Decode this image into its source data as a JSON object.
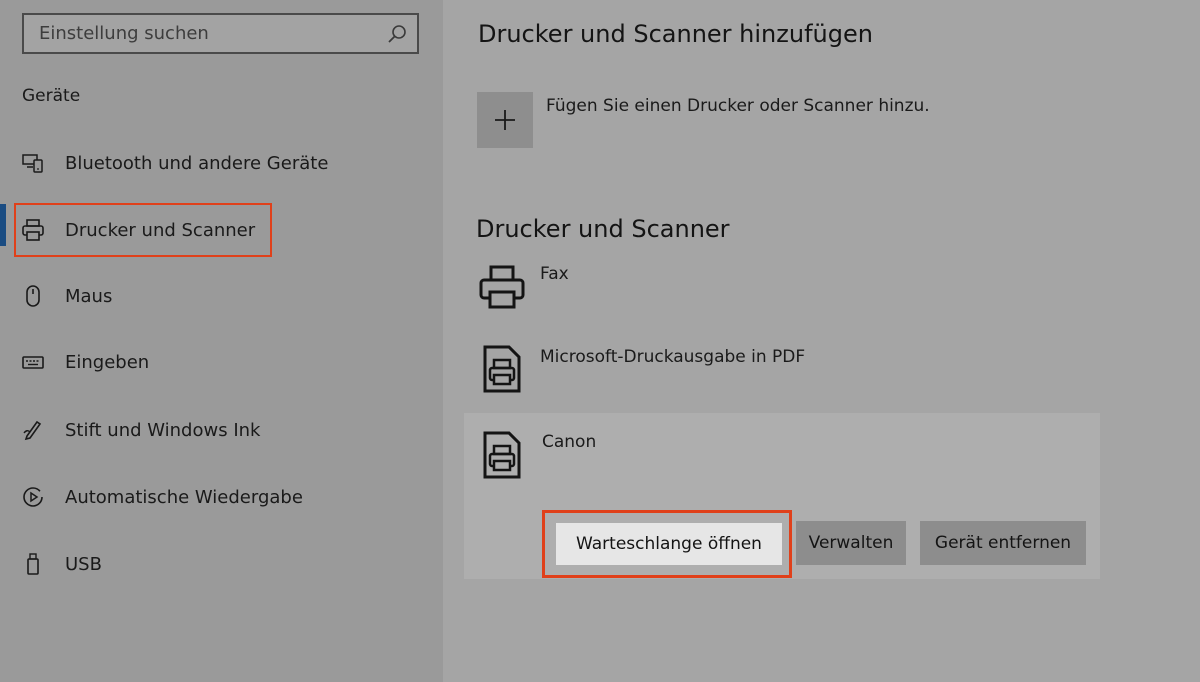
{
  "search": {
    "placeholder": "Einstellung suchen"
  },
  "sidebar": {
    "section_title": "Geräte",
    "items": [
      {
        "label": "Bluetooth und andere Geräte",
        "icon": "bluetooth-devices-icon"
      },
      {
        "label": "Drucker und Scanner",
        "icon": "printer-icon",
        "active": true
      },
      {
        "label": "Maus",
        "icon": "mouse-icon"
      },
      {
        "label": "Eingeben",
        "icon": "keyboard-icon"
      },
      {
        "label": "Stift und Windows Ink",
        "icon": "pen-icon"
      },
      {
        "label": "Automatische Wiedergabe",
        "icon": "autoplay-icon"
      },
      {
        "label": "USB",
        "icon": "usb-icon"
      }
    ]
  },
  "main": {
    "add_section_title": "Drucker und Scanner hinzufügen",
    "add_label": "Fügen Sie einen Drucker oder Scanner hinzu.",
    "devices_section_title": "Drucker und Scanner",
    "devices": [
      {
        "name": "Fax",
        "icon": "fax-printer-icon"
      },
      {
        "name": "Microsoft-Druckausgabe in PDF",
        "icon": "document-printer-icon"
      },
      {
        "name": "Canon",
        "icon": "document-printer-icon",
        "selected": true
      }
    ],
    "buttons": {
      "open_queue": "Warteschlange öffnen",
      "manage": "Verwalten",
      "remove": "Gerät entfernen"
    }
  },
  "colors": {
    "highlight": "#e0401a",
    "accent": "#1a4c82"
  }
}
